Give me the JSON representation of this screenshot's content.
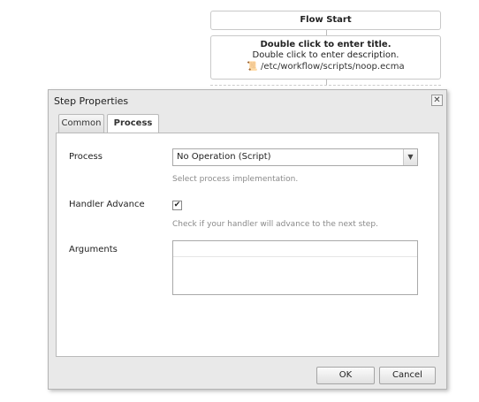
{
  "workflow": {
    "flow_start": "Flow Start",
    "step_title": "Double click to enter title.",
    "step_description": "Double click to enter description.",
    "step_script": "/etc/workflow/scripts/noop.ecma"
  },
  "dialog": {
    "title": "Step Properties",
    "close_glyph": "✕",
    "tabs": [
      {
        "label": "Common"
      },
      {
        "label": "Process"
      }
    ],
    "process": {
      "label": "Process",
      "value": "No Operation (Script)",
      "hint": "Select process implementation."
    },
    "handler_advance": {
      "label": "Handler Advance",
      "checked_glyph": "✔",
      "hint": "Check if your handler will advance to the next step."
    },
    "arguments": {
      "label": "Arguments",
      "value": ""
    },
    "ok_label": "OK",
    "cancel_label": "Cancel"
  }
}
